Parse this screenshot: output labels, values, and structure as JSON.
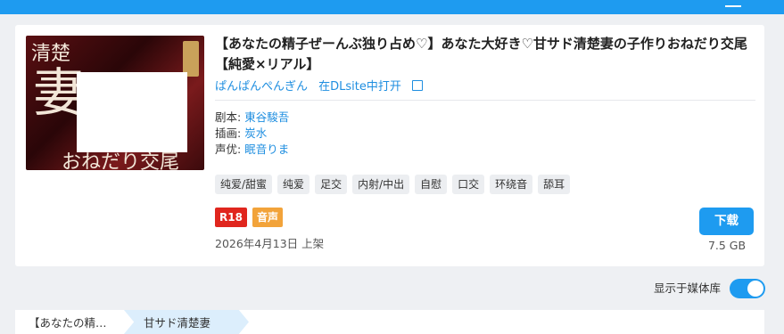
{
  "work": {
    "title": "【あなたの精子ぜーんぶ独り占め♡】あなた大好き♡甘サド清楚妻の子作りおねだり交尾【純愛×リアル】",
    "circle": "ぱんぱんぺんぎん",
    "open_link_label": "在DLsite中打开",
    "script_label": "剧本:",
    "script_value": "東谷駿吾",
    "illustration_label": "插画:",
    "illustration_value": "炭水",
    "cv_label": "声优:",
    "cv_value": "眠音りま",
    "cover_text": {
      "line1": "清楚",
      "line2": "妻",
      "line3": "おねだり交尾"
    },
    "tags": [
      "纯爱/甜蜜",
      "纯爱",
      "足交",
      "内射/中出",
      "自慰",
      "口交",
      "环绕音",
      "舔耳"
    ],
    "badges": [
      {
        "label": "R18",
        "color": "#e0261e"
      },
      {
        "label": "音声",
        "color": "#f2a33a"
      }
    ],
    "release_date": "2026年4月13日 上架",
    "download_label": "下载",
    "size": "7.5 GB"
  },
  "library_toggle": {
    "label": "显示于媒体库",
    "enabled": true
  },
  "breadcrumb": [
    "【あなたの精…",
    "甘サド清楚妻"
  ],
  "colors": {
    "accent": "#1e9bf0",
    "link": "#1e8ee0"
  }
}
